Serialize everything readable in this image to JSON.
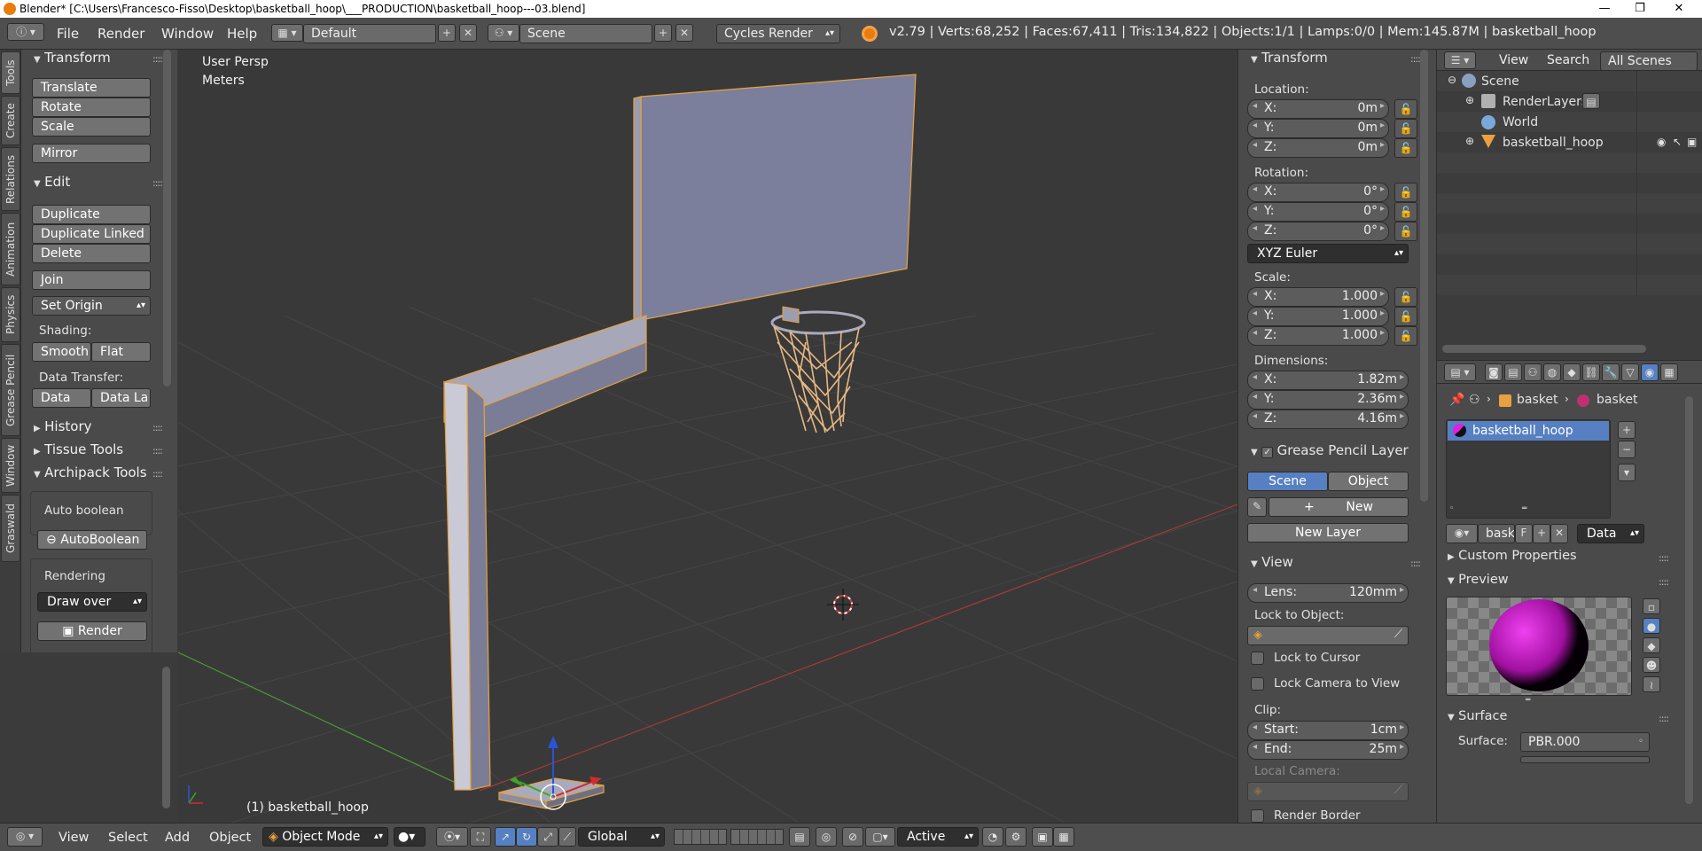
{
  "title_bar": {
    "text": "Blender* [C:\\Users\\Francesco-Fisso\\Desktop\\basketball_hoop\\___PRODUCTION\\basketball_hoop---03.blend]",
    "minimize": "—",
    "maximize": "❐",
    "close": "✕"
  },
  "info_header": {
    "menus": [
      "File",
      "Render",
      "Window",
      "Help"
    ],
    "screen_layout": "Default",
    "scene": "Scene",
    "render_engine": "Cycles Render",
    "stats": "v2.79 | Verts:68,252 | Faces:67,411 | Tris:134,822 | Objects:1/1 | Lamps:0/0 | Mem:145.87M | basketball_hoop"
  },
  "tool_tabs": [
    "Tools",
    "Create",
    "Relations",
    "Animation",
    "Physics",
    "Grease Pencil",
    "Window",
    "Graswald"
  ],
  "tool_shelf": {
    "transform": {
      "title": "Transform",
      "buttons": [
        "Translate",
        "Rotate",
        "Scale",
        "Mirror"
      ]
    },
    "edit": {
      "title": "Edit",
      "buttons": [
        "Duplicate",
        "Duplicate Linked",
        "Delete",
        "Join"
      ],
      "set_origin": "Set Origin",
      "shading_label": "Shading:",
      "smooth": "Smooth",
      "flat": "Flat",
      "data_transfer_label": "Data Transfer:",
      "data": "Data",
      "data_la": "Data La"
    },
    "history": "History",
    "tissue_tools": "Tissue Tools",
    "archipack": "Archipack Tools",
    "auto_boolean_label": "Auto boolean",
    "auto_boolean_btn": "AutoBoolean",
    "rendering_label": "Rendering",
    "draw_over": "Draw over",
    "render_btn": "Render"
  },
  "viewport": {
    "view_name": "User Persp",
    "units": "Meters",
    "active_object": "(1) basketball_hoop"
  },
  "n_panel": {
    "transform_title": "Transform",
    "location_label": "Location:",
    "location": [
      {
        "k": "X:",
        "v": "0m"
      },
      {
        "k": "Y:",
        "v": "0m"
      },
      {
        "k": "Z:",
        "v": "0m"
      }
    ],
    "rotation_label": "Rotation:",
    "rotation": [
      {
        "k": "X:",
        "v": "0°"
      },
      {
        "k": "Y:",
        "v": "0°"
      },
      {
        "k": "Z:",
        "v": "0°"
      }
    ],
    "rotation_mode": "XYZ Euler",
    "scale_label": "Scale:",
    "scale": [
      {
        "k": "X:",
        "v": "1.000"
      },
      {
        "k": "Y:",
        "v": "1.000"
      },
      {
        "k": "Z:",
        "v": "1.000"
      }
    ],
    "dimensions_label": "Dimensions:",
    "dimensions": [
      {
        "k": "X:",
        "v": "1.82m"
      },
      {
        "k": "Y:",
        "v": "2.36m"
      },
      {
        "k": "Z:",
        "v": "4.16m"
      }
    ],
    "gp_title": "Grease Pencil Layer",
    "gp_scene": "Scene",
    "gp_object": "Object",
    "gp_new": "New",
    "gp_new_layer": "New Layer",
    "view_title": "View",
    "lens_label": "Lens:",
    "lens": "120mm",
    "lock_to_object": "Lock to Object:",
    "lock_to_cursor": "Lock to Cursor",
    "lock_camera": "Lock Camera to View",
    "clip_label": "Clip:",
    "clip_start_label": "Start:",
    "clip_start": "1cm",
    "clip_end_label": "End:",
    "clip_end": "25m",
    "local_camera": "Local Camera:",
    "render_border": "Render Border"
  },
  "outliner": {
    "menus": [
      "View",
      "Search"
    ],
    "filter": "All Scenes",
    "tree": [
      "Scene",
      "RenderLayers",
      "World",
      "basketball_hoop"
    ]
  },
  "properties": {
    "breadcrumb": [
      "basket",
      "basket"
    ],
    "material_slot": "basketball_hoop",
    "mat_name": "bask",
    "mat_f": "F",
    "data_link": "Data",
    "custom_props": "Custom Properties",
    "preview": "Preview",
    "surface_title": "Surface",
    "surface_label": "Surface:",
    "surface_value": "PBR.000"
  },
  "bottom_bar": {
    "menus": [
      "View",
      "Select",
      "Add",
      "Object"
    ],
    "mode": "Object Mode",
    "pivot": "Global",
    "proportional": "Active"
  },
  "colors": {
    "selection_outline": "#e8a040",
    "object_fill": "#7b7f9c",
    "net": "#e8b882",
    "grid": "#4a4a4a",
    "x_axis": "#a53a3a",
    "y_axis": "#4f9a33",
    "highlight": "#5680c2"
  }
}
